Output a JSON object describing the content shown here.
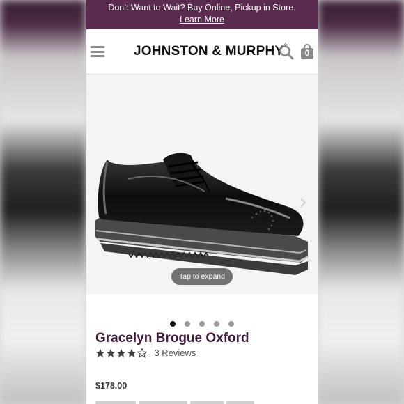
{
  "promo": {
    "text": "Don’t Want to Wait? Buy Online, Pickup in Store.",
    "link": "Learn More"
  },
  "header": {
    "logo": "JOHNSTON & MURPHY",
    "logo_reg": "®",
    "cart_count": "0"
  },
  "gallery": {
    "expand_label": "Tap to expand",
    "slide_count": 5,
    "active_slide": 1
  },
  "product": {
    "name": "Gracelyn Brogue Oxford",
    "rating": 4.5,
    "rating_max": 5,
    "reviews_label": "3 Reviews",
    "price": "$178.00"
  },
  "colors": {
    "promo_bg": "#5b2a4f",
    "title": "#3f1a39",
    "icon_gray": "#8a8a8a"
  }
}
